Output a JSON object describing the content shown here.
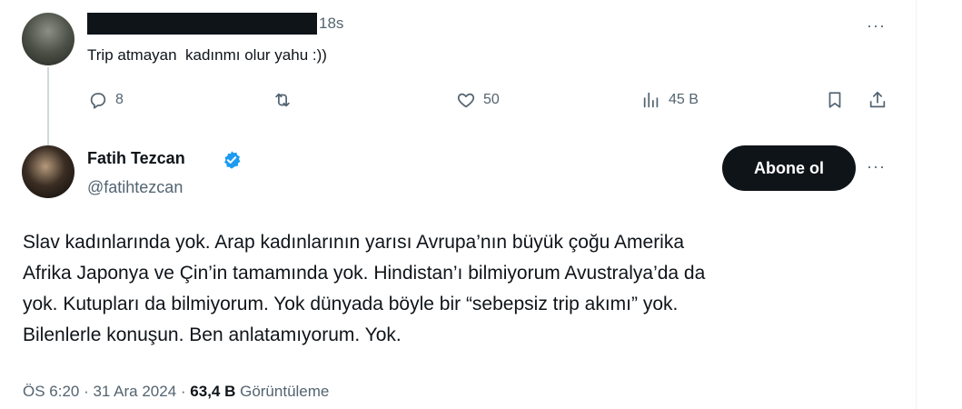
{
  "reply_tweet": {
    "time": "18s",
    "text": "Trip atmayan  kadınmı olur yahu :))",
    "more_label": "···",
    "actions": {
      "replies": "8",
      "retweets": "",
      "likes": "50",
      "views": "45 B"
    }
  },
  "main_tweet": {
    "author_name": "Fatih Tezcan",
    "handle": "@fatihtezcan",
    "follow_button": "Abone ol",
    "more_label": "···",
    "body_lines": [
      "Slav kadınlarında yok. Arap kadınlarının yarısı Avrupa’nın büyük çoğu Amerika",
      "Afrika Japonya ve Çin’in tamamında yok. Hindistan’ı bilmiyorum Avustralya’da da",
      "yok. Kutupları da bilmiyorum. Yok dünyada böyle bir “sebepsiz trip akımı” yok.",
      "Bilenlerle konuşun. Ben anlatamıyorum. Yok."
    ],
    "timestamp": "ÖS 6:20 · 31 Ara 2024 · ",
    "views_count": "63,4 B",
    "views_label": " Görüntüleme"
  },
  "icons": {
    "reply": "reply-icon",
    "retweet": "retweet-icon",
    "like": "heart-icon",
    "views": "analytics-icon",
    "bookmark": "bookmark-icon",
    "share": "share-icon",
    "verified": "verified-badge-icon"
  },
  "colors": {
    "text": "#0f1419",
    "secondary": "#536471",
    "verified": "#1d9bf0",
    "button_bg": "#0f1419"
  }
}
